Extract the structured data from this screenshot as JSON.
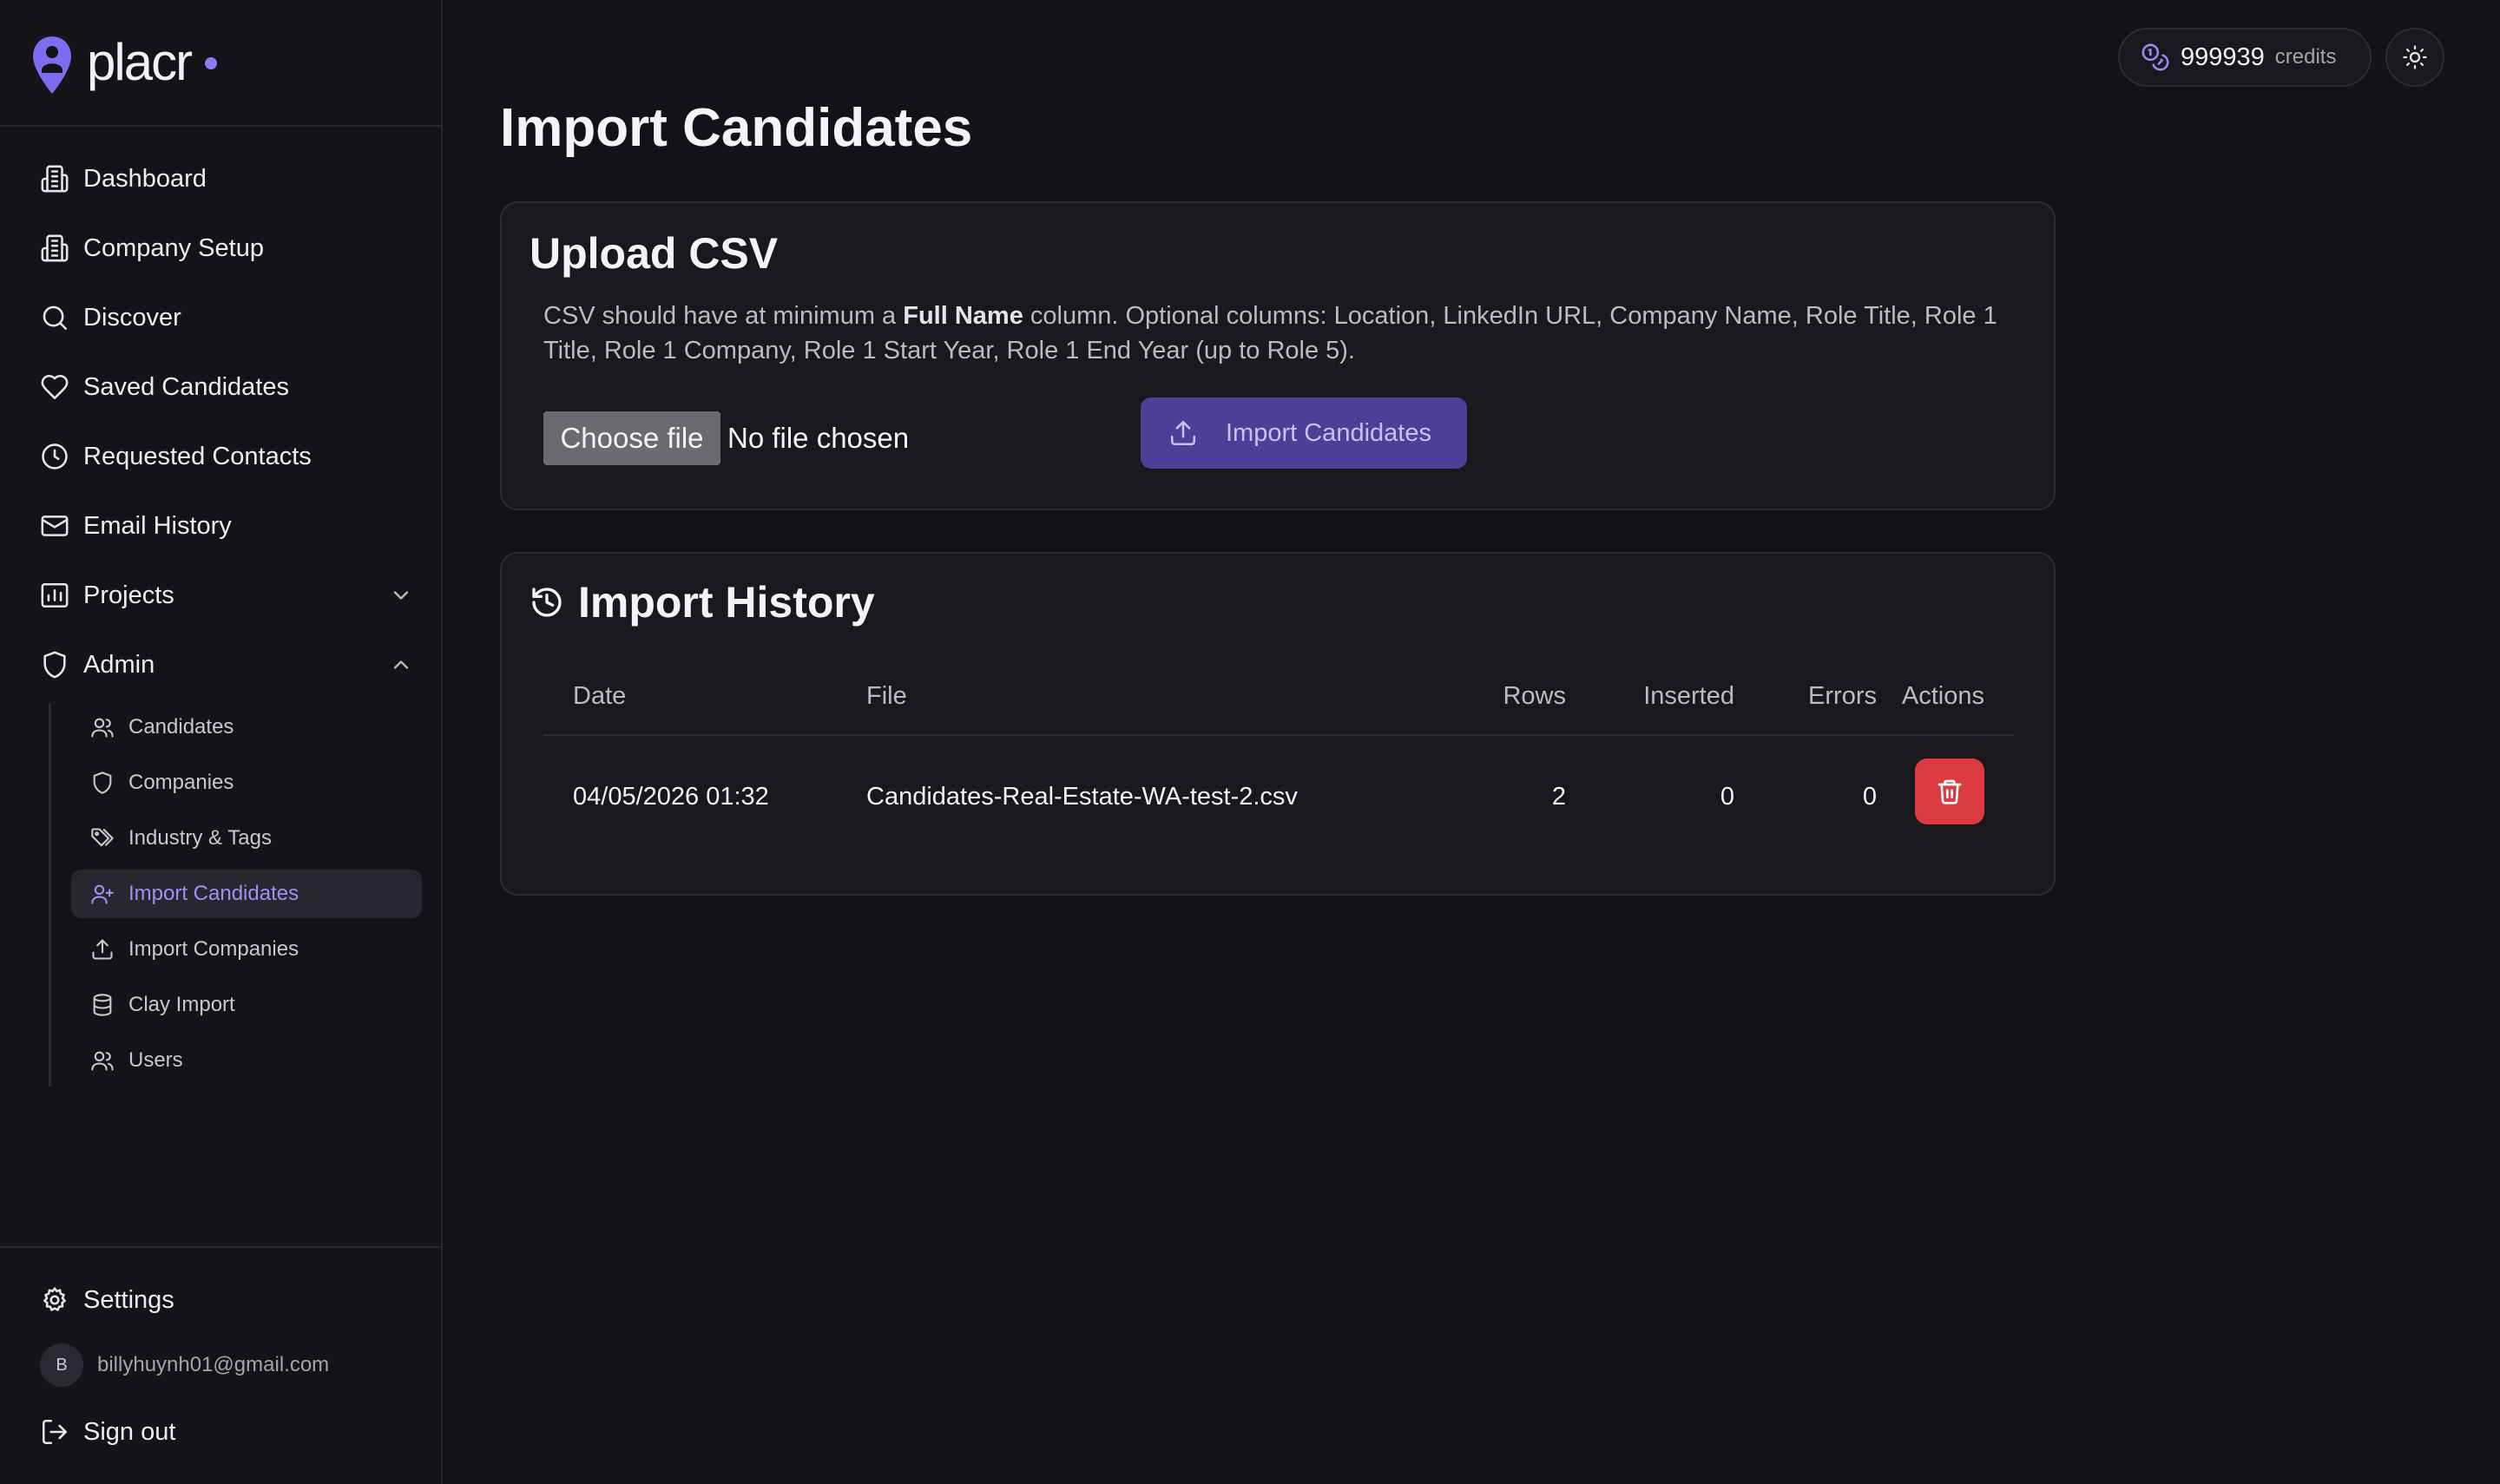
{
  "brand": {
    "name": "placr"
  },
  "sidebar": {
    "nav": [
      {
        "label": "Dashboard",
        "icon": "building-icon"
      },
      {
        "label": "Company Setup",
        "icon": "building-icon"
      },
      {
        "label": "Discover",
        "icon": "search-icon"
      },
      {
        "label": "Saved Candidates",
        "icon": "heart-icon"
      },
      {
        "label": "Requested Contacts",
        "icon": "clock-icon"
      },
      {
        "label": "Email History",
        "icon": "mail-icon"
      },
      {
        "label": "Projects",
        "icon": "chart-icon",
        "expanded": false
      },
      {
        "label": "Admin",
        "icon": "shield-icon",
        "expanded": true
      }
    ],
    "admin_items": [
      {
        "label": "Candidates",
        "icon": "users-icon"
      },
      {
        "label": "Companies",
        "icon": "shield-icon"
      },
      {
        "label": "Industry & Tags",
        "icon": "tags-icon"
      },
      {
        "label": "Import Candidates",
        "icon": "user-plus-icon",
        "active": true
      },
      {
        "label": "Import Companies",
        "icon": "upload-icon"
      },
      {
        "label": "Clay Import",
        "icon": "database-icon"
      },
      {
        "label": "Users",
        "icon": "users-icon"
      }
    ],
    "footer": {
      "settings_label": "Settings",
      "avatar_initial": "B",
      "email": "billyhuynh01@gmail.com",
      "signout_label": "Sign out"
    }
  },
  "header": {
    "credits_value": "999939",
    "credits_label": "credits"
  },
  "main": {
    "title": "Import Candidates",
    "upload": {
      "title": "Upload CSV",
      "desc_prefix": "CSV should have at minimum a ",
      "desc_bold": "Full Name",
      "desc_suffix": " column. Optional columns: Location, LinkedIn URL, Company Name, Role Title, Role 1 Title, Role 1 Company, Role 1 Start Year, Role 1 End Year (up to Role 5).",
      "choose_file_label": "Choose file",
      "file_status": "No file chosen",
      "import_button_label": "Import Candidates"
    },
    "history": {
      "title": "Import History",
      "columns": [
        "Date",
        "File",
        "Rows",
        "Inserted",
        "Errors",
        "Actions"
      ],
      "rows": [
        {
          "date": "04/05/2026 01:32",
          "file": "Candidates-Real-Estate-WA-test-2.csv",
          "rows": "2",
          "inserted": "0",
          "errors": "0"
        }
      ]
    }
  },
  "colors": {
    "accent": "#8b7cf6",
    "primary_button": "#4b3f97",
    "danger": "#dc3c41",
    "background": "#141217",
    "card": "#1a181e"
  }
}
